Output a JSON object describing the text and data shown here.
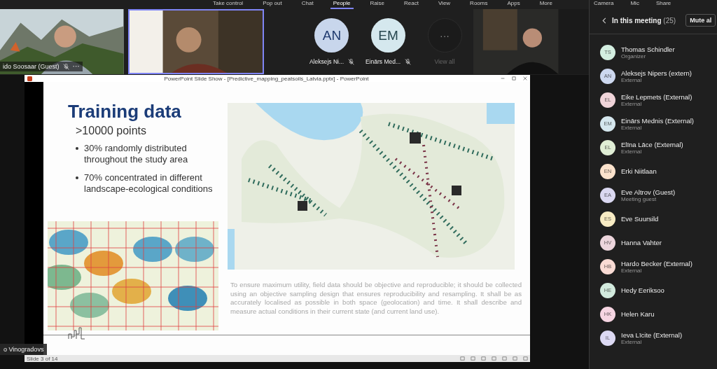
{
  "toolbar": {
    "items": [
      {
        "label": "Take control",
        "selected": false
      },
      {
        "label": "Pop out",
        "selected": false
      },
      {
        "label": "Chat",
        "selected": false
      },
      {
        "label": "People",
        "selected": true
      },
      {
        "label": "Raise",
        "selected": false
      },
      {
        "label": "React",
        "selected": false
      },
      {
        "label": "View",
        "selected": false
      },
      {
        "label": "Rooms",
        "selected": false
      },
      {
        "label": "Apps",
        "selected": false
      },
      {
        "label": "More",
        "selected": false
      }
    ],
    "device_controls": [
      "Camera",
      "Mic",
      "Share"
    ]
  },
  "video_tiles": [
    {
      "kind": "video",
      "name": "ido Soosaar (Guest)",
      "muted": true,
      "more": "···",
      "speaking": false
    },
    {
      "kind": "video",
      "speaking": true
    },
    {
      "kind": "avatar",
      "initials": "AN",
      "name": "Aleksejs Ni...",
      "muted": true
    },
    {
      "kind": "avatar",
      "initials": "EM",
      "name": "Einārs Med...",
      "muted": true
    },
    {
      "kind": "view_all",
      "glyph": "···",
      "name": "View all"
    },
    {
      "kind": "video",
      "speaking": false
    }
  ],
  "presenter_label": "o Vinogradovs",
  "slideshow": {
    "window_title": "PowerPoint Slide Show - [Predictive_mapping_peatsoils_Latvia.pptx] - PowerPoint",
    "status": "Slide 3 of 14",
    "slide": {
      "title": "Training data",
      "subtitle": ">10000 points",
      "bullets": [
        "30% randomly distributed throughout the study area",
        "70% concentrated in different landscape-ecological conditions"
      ],
      "paragraph": "To ensure maximum utility, field data should be objective and reproducible; it should be collected using an objective sampling design that ensures reproducibility and resampling. It shall be as accurately localised as possible in both space (geolocation) and time. It shall describe and measure actual conditions in their current state (and current land use)."
    }
  },
  "people_panel": {
    "title": "In this meeting",
    "count": "(25)",
    "mute_button": "Mute al",
    "participants": [
      {
        "initials": "TS",
        "name": "Thomas Schindler",
        "role": "Organizer",
        "color": "#d3eee0"
      },
      {
        "initials": "AN",
        "name": "Aleksejs Nipers (extern)",
        "role": "External",
        "color": "#cdd8ef"
      },
      {
        "initials": "EL",
        "name": "Eike Lepmets (External)",
        "role": "External",
        "color": "#f0d4d9"
      },
      {
        "initials": "EM",
        "name": "Einārs Mednis (External)",
        "role": "External",
        "color": "#d5e7ee"
      },
      {
        "initials": "EL",
        "name": "Elīna Lāce (External)",
        "role": "External",
        "color": "#e0eed5"
      },
      {
        "initials": "EN",
        "name": "Erki Niitlaan",
        "color": "#fbe2cc"
      },
      {
        "initials": "EA",
        "name": "Eve Altrov (Guest)",
        "role": "Meeting guest",
        "color": "#dad8f1"
      },
      {
        "initials": "ES",
        "name": "Eve Suursild",
        "color": "#f8ecc4"
      },
      {
        "initials": "HV",
        "name": "Hanna Vahter",
        "color": "#ecd5dc"
      },
      {
        "initials": "HB",
        "name": "Hardo Becker (External)",
        "role": "External",
        "color": "#f9dbd4"
      },
      {
        "initials": "HE",
        "name": "Hedy Eeriksoo",
        "color": "#d2eadd"
      },
      {
        "initials": "HK",
        "name": "Helen Karu",
        "color": "#f6d5e2"
      },
      {
        "initials": "IL",
        "name": "Ieva Līcite (External)",
        "role": "External",
        "color": "#dcd9f3"
      }
    ]
  }
}
